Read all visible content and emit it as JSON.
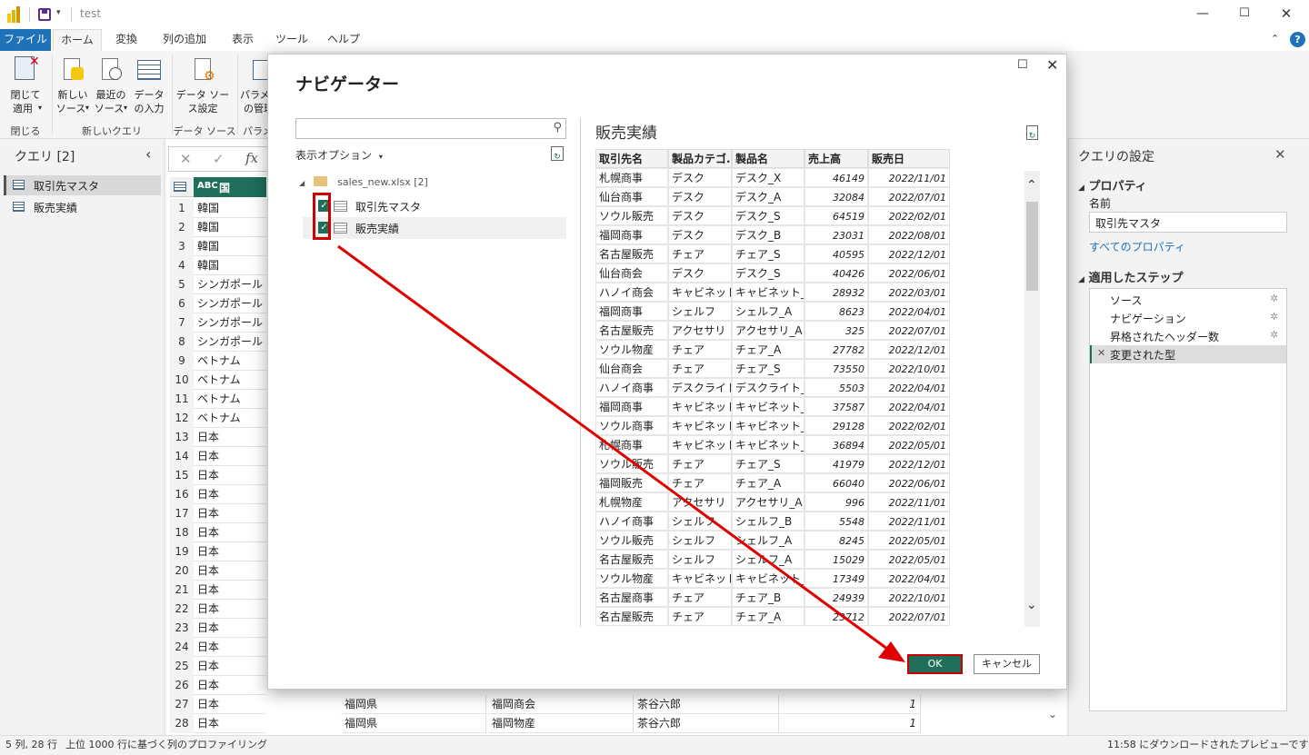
{
  "app": {
    "title": "test",
    "accent": "#f2c811",
    "highlight": "#cc0000",
    "ok_color": "#1e6e5a"
  },
  "ribbon": {
    "tabs": [
      "ファイル",
      "ホーム",
      "変換",
      "列の追加",
      "表示",
      "ツール",
      "ヘルプ"
    ],
    "buttons": {
      "close_apply": [
        "閉じて",
        "適用"
      ],
      "new_source": [
        "新しい",
        "ソース"
      ],
      "recent_source": [
        "最近の",
        "ソース"
      ],
      "enter_data": [
        "データ",
        "の入力"
      ],
      "data_source_settings": [
        "データ ソー",
        "ス設定"
      ],
      "parameters": [
        "パラメー",
        "の管理"
      ]
    },
    "groups": {
      "close": "閉じる",
      "new_query": "新しいクエリ",
      "data_source": "データ ソース",
      "params": "パラメー"
    }
  },
  "left_pane": {
    "title": "クエリ [2]",
    "queries": [
      "取引先マスタ",
      "販売実績"
    ]
  },
  "grid": {
    "col_header": "国",
    "rows": [
      [
        1,
        "韓国"
      ],
      [
        2,
        "韓国"
      ],
      [
        3,
        "韓国"
      ],
      [
        4,
        "韓国"
      ],
      [
        5,
        "シンガポール"
      ],
      [
        6,
        "シンガポール"
      ],
      [
        7,
        "シンガポール"
      ],
      [
        8,
        "シンガポール"
      ],
      [
        9,
        "ベトナム"
      ],
      [
        10,
        "ベトナム"
      ],
      [
        11,
        "ベトナム"
      ],
      [
        12,
        "ベトナム"
      ],
      [
        13,
        "日本"
      ],
      [
        14,
        "日本"
      ],
      [
        15,
        "日本"
      ],
      [
        16,
        "日本"
      ],
      [
        17,
        "日本"
      ],
      [
        18,
        "日本"
      ],
      [
        19,
        "日本"
      ],
      [
        20,
        "日本"
      ],
      [
        21,
        "日本"
      ],
      [
        22,
        "日本"
      ],
      [
        23,
        "日本"
      ],
      [
        24,
        "日本"
      ],
      [
        25,
        "日本"
      ],
      [
        26,
        "日本"
      ],
      [
        27,
        "日本"
      ],
      [
        28,
        "日本"
      ]
    ],
    "bottom_rows": [
      {
        "n": 27,
        "c1": "福岡県",
        "c2": "福岡商会",
        "c3": "茶谷六郎",
        "c4": "1"
      },
      {
        "n": 28,
        "c1": "福岡県",
        "c2": "福岡物産",
        "c3": "茶谷六郎",
        "c4": "1"
      }
    ]
  },
  "right_pane": {
    "title": "クエリの設定",
    "properties_header": "プロパティ",
    "name_label": "名前",
    "name_value": "取引先マスタ",
    "all_properties": "すべてのプロパティ",
    "steps_header": "適用したステップ",
    "steps": [
      "ソース",
      "ナビゲーション",
      "昇格されたヘッダー数",
      "変更された型"
    ]
  },
  "status": {
    "left": "5 列, 28 行",
    "middle": "上位 1000 行に基づく列のプロファイリング",
    "right": "11:58 にダウンロードされたプレビューです"
  },
  "navigator": {
    "title": "ナビゲーター",
    "search_placeholder": "",
    "display_options": "表示オプション",
    "file_node": "sales_new.xlsx [2]",
    "items": [
      "取引先マスタ",
      "販売実績"
    ],
    "preview_title": "販売実績",
    "ok": "OK",
    "cancel": "キャンセル",
    "columns": [
      "取引先名",
      "製品カテゴ...",
      "製品名",
      "売上高",
      "販売日"
    ],
    "rows": [
      [
        "札幌商事",
        "デスク",
        "デスク_X",
        "46149",
        "2022/11/01"
      ],
      [
        "仙台商事",
        "デスク",
        "デスク_A",
        "32084",
        "2022/07/01"
      ],
      [
        "ソウル販売",
        "デスク",
        "デスク_S",
        "64519",
        "2022/02/01"
      ],
      [
        "福岡商事",
        "デスク",
        "デスク_B",
        "23031",
        "2022/08/01"
      ],
      [
        "名古屋販売",
        "チェア",
        "チェア_S",
        "40595",
        "2022/12/01"
      ],
      [
        "仙台商会",
        "デスク",
        "デスク_S",
        "40426",
        "2022/06/01"
      ],
      [
        "ハノイ商会",
        "キャビネット",
        "キャビネット_S",
        "28932",
        "2022/03/01"
      ],
      [
        "福岡商事",
        "シェルフ",
        "シェルフ_A",
        "8623",
        "2022/04/01"
      ],
      [
        "名古屋販売",
        "アクセサリ",
        "アクセサリ_A",
        "325",
        "2022/07/01"
      ],
      [
        "ソウル物産",
        "チェア",
        "チェア_A",
        "27782",
        "2022/12/01"
      ],
      [
        "仙台商会",
        "チェア",
        "チェア_S",
        "73550",
        "2022/10/01"
      ],
      [
        "ハノイ商事",
        "デスクライト",
        "デスクライト_B",
        "5503",
        "2022/04/01"
      ],
      [
        "福岡商事",
        "キャビネット",
        "キャビネット_S",
        "37587",
        "2022/04/01"
      ],
      [
        "ソウル商事",
        "キャビネット",
        "キャビネット_B",
        "29128",
        "2022/02/01"
      ],
      [
        "札幌商事",
        "キャビネット",
        "キャビネット_S",
        "36894",
        "2022/05/01"
      ],
      [
        "ソウル販売",
        "チェア",
        "チェア_S",
        "41979",
        "2022/12/01"
      ],
      [
        "福岡販売",
        "チェア",
        "チェア_A",
        "66040",
        "2022/06/01"
      ],
      [
        "札幌物産",
        "アクセサリ",
        "アクセサリ_A",
        "996",
        "2022/11/01"
      ],
      [
        "ハノイ商事",
        "シェルフ",
        "シェルフ_B",
        "5548",
        "2022/11/01"
      ],
      [
        "ソウル販売",
        "シェルフ",
        "シェルフ_A",
        "8245",
        "2022/05/01"
      ],
      [
        "名古屋販売",
        "シェルフ",
        "シェルフ_A",
        "15029",
        "2022/05/01"
      ],
      [
        "ソウル物産",
        "キャビネット",
        "キャビネット_B",
        "17349",
        "2022/04/01"
      ],
      [
        "名古屋商事",
        "チェア",
        "チェア_B",
        "24939",
        "2022/10/01"
      ],
      [
        "名古屋販売",
        "チェア",
        "チェア_A",
        "23712",
        "2022/07/01"
      ]
    ]
  }
}
